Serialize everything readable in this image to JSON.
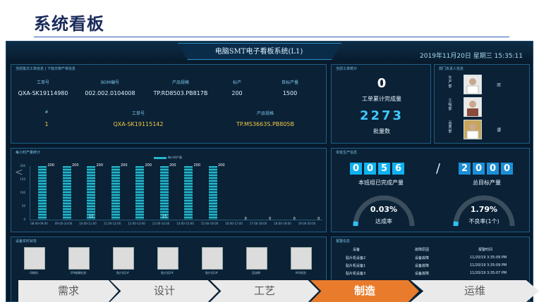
{
  "slide": {
    "title": "系统看板"
  },
  "header": {
    "system_title": "电脑SMT电子看板系统(L1)",
    "datetime": "2019年11月20日 星期三 15:35:11"
  },
  "order_panel": {
    "title": "当前批次工单信息 | 下批次排产单信息",
    "headers": [
      "工单号",
      "BOM编号",
      "产品规格",
      "标产",
      "目标产量"
    ],
    "row": [
      "QXA-SK19114980",
      "002.002.0104008",
      "TP.RD8503.PB817B",
      "200",
      "1500"
    ],
    "next_headers": [
      "#",
      "工单号",
      "产品规格"
    ],
    "next_row": [
      "1",
      "QXA-SK19115142",
      "TP.MS3663S.PB805B"
    ]
  },
  "stats_panel": {
    "title": "当前工单统计",
    "completed_value": "0",
    "completed_label": "工单累计完成量",
    "batch_value": "2273",
    "batch_label": "批量数"
  },
  "staff_panel": {
    "title": "部门负责人信息",
    "members": [
      {
        "dept": "生产部",
        "name": "邓"
      },
      {
        "dept": "工程部",
        "name": ""
      },
      {
        "dept": "品质部",
        "name": "谭"
      }
    ]
  },
  "hourly_panel": {
    "title": "每小时产量统计",
    "legend": "每小时产量"
  },
  "chart_data": {
    "type": "bar",
    "categories": [
      "08:00-09:00",
      "09:00-10:00",
      "10:00-11:00",
      "11:00-12:00",
      "12:00-13:00",
      "13:00-14:00",
      "14:00-15:00",
      "15:00-16:00",
      "16:00-17:00",
      "17:00-18:00",
      "18:00-19:00",
      "19:00-20:00"
    ],
    "values": [
      200,
      200,
      200,
      200,
      200,
      200,
      200,
      200,
      0,
      0,
      0,
      0
    ],
    "inner_labels": [
      "",
      "",
      "11",
      "",
      "",
      "13",
      "",
      "",
      "",
      "",
      "",
      ""
    ],
    "y_ticks": [
      "200",
      "150",
      "100",
      "50",
      "0"
    ],
    "ylim": [
      0,
      200
    ]
  },
  "production_panel": {
    "title": "本班生产信息",
    "completed_digits": [
      "0",
      "0",
      "5",
      "6"
    ],
    "completed_label": "本班组已完成产量",
    "target_digits": [
      "2",
      "0",
      "0",
      "0"
    ],
    "target_label": "总目标产量",
    "rate_value": "0.03%",
    "rate_fraction": 0.0003,
    "rate_label": "达成率",
    "defect_value": "1.79%",
    "defect_fraction": 0.0179,
    "defect_label": "不良率(1个)"
  },
  "equipment_panel": {
    "title": "设备实时状态",
    "machines": [
      "印刷机",
      "SPI锡膏检测",
      "贴片机1#",
      "贴片机2#",
      "贴片机3#",
      "回流焊",
      "AOI检测"
    ]
  },
  "alarm_panel": {
    "title": "报警信息",
    "headers": [
      "设备",
      "故障原因",
      "报警时间"
    ],
    "rows": [
      [
        "贴片机设备2",
        "设备故障",
        "11/20/19 3:35:09 PM"
      ],
      [
        "贴片机设备1",
        "设备故障",
        "11/20/19 3:35:09 PM"
      ],
      [
        "贴片机设备3",
        "设备故障",
        "11/20/19 3:35:07 PM"
      ]
    ]
  },
  "nav": {
    "steps": [
      "需求",
      "设计",
      "工艺",
      "制造",
      "运维"
    ],
    "active_index": 3
  }
}
